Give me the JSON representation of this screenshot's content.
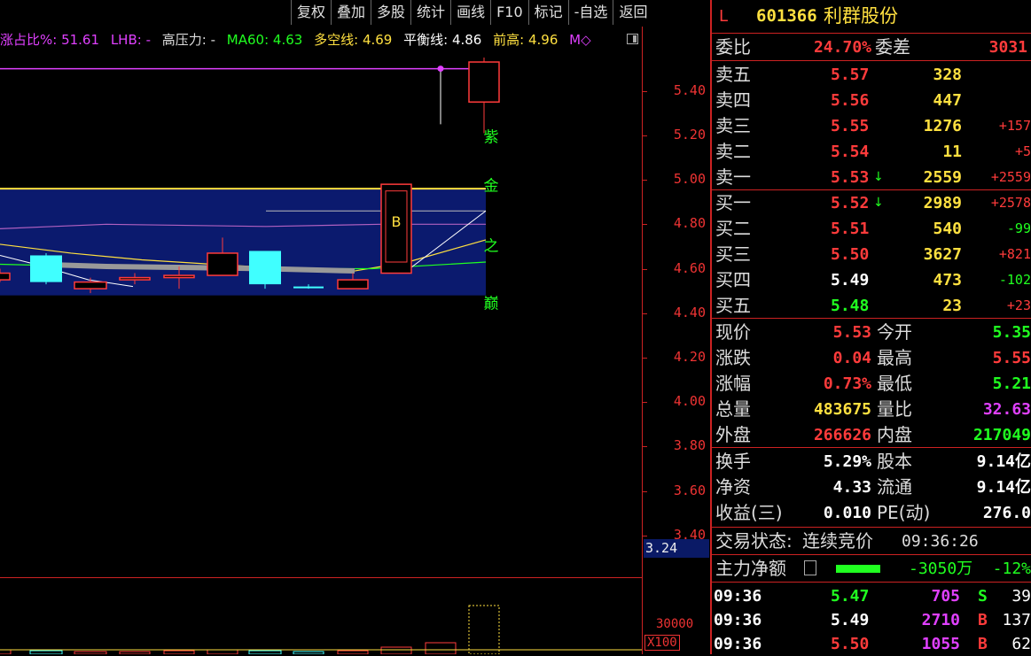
{
  "toolbar": [
    "复权",
    "叠加",
    "多股",
    "统计",
    "画线",
    "F10",
    "标记",
    "-自选",
    "返回"
  ],
  "indicator": {
    "zhan_label": "涨占比%: ",
    "zhan_value": "51.61",
    "lhb_label": "LHB: ",
    "lhb_value": "-",
    "gyl_label": "高压力: ",
    "gyl_value": "-",
    "ma60_label": "MA60: ",
    "ma60_value": "4.63",
    "dkx_label": "多空线: ",
    "dkx_value": "4.69",
    "phx_label": "平衡线: ",
    "phx_value": "4.86",
    "qg_label": "前高: ",
    "qg_value": "4.96",
    "more": "M◇"
  },
  "chart_labels": [
    "紫",
    "金",
    "之",
    "巅"
  ],
  "candle_mark": "B",
  "price_axis": [
    "5.40",
    "5.20",
    "5.00",
    "4.80",
    "4.60",
    "4.40",
    "4.20",
    "4.00",
    "3.80",
    "3.60",
    "3.40"
  ],
  "axis_current": "3.24",
  "vol_axis": "30000",
  "vol_unit": "X100",
  "header": {
    "market": "L",
    "code": "601366",
    "name": "利群股份"
  },
  "weibi": {
    "label1": "委比",
    "value1": "24.70%",
    "label2": "委差",
    "value2": "3031"
  },
  "sell": [
    {
      "label": "卖五",
      "price": "5.57",
      "vol": "328",
      "chg": ""
    },
    {
      "label": "卖四",
      "price": "5.56",
      "vol": "447",
      "chg": ""
    },
    {
      "label": "卖三",
      "price": "5.55",
      "vol": "1276",
      "chg": "+157"
    },
    {
      "label": "卖二",
      "price": "5.54",
      "vol": "11",
      "chg": "+5"
    },
    {
      "label": "卖一",
      "price": "5.53",
      "vol": "2559",
      "chg": "+2559"
    }
  ],
  "buy": [
    {
      "label": "买一",
      "price": "5.52",
      "vol": "2989",
      "chg": "+2578"
    },
    {
      "label": "买二",
      "price": "5.51",
      "vol": "540",
      "chg": "-99"
    },
    {
      "label": "买三",
      "price": "5.50",
      "vol": "3627",
      "chg": "+821"
    },
    {
      "label": "买四",
      "price": "5.49",
      "vol": "473",
      "chg": "-102"
    },
    {
      "label": "买五",
      "price": "5.48",
      "vol": "23",
      "chg": "+23"
    }
  ],
  "quote": [
    {
      "l1": "现价",
      "v1": "5.53",
      "l2": "今开",
      "v2": "5.35"
    },
    {
      "l1": "涨跌",
      "v1": "0.04",
      "l2": "最高",
      "v2": "5.55"
    },
    {
      "l1": "涨幅",
      "v1": "0.73%",
      "l2": "最低",
      "v2": "5.21"
    },
    {
      "l1": "总量",
      "v1": "483675",
      "l2": "量比",
      "v2": "32.63"
    },
    {
      "l1": "外盘",
      "v1": "266626",
      "l2": "内盘",
      "v2": "217049"
    }
  ],
  "fund": [
    {
      "l1": "换手",
      "v1": "5.29%",
      "l2": "股本",
      "v2": "9.14亿"
    },
    {
      "l1": "净资",
      "v1": "4.33",
      "l2": "流通",
      "v2": "9.14亿"
    },
    {
      "l1": "收益(三)",
      "v1": "0.010",
      "l2": "PE(动)",
      "v2": "276.0"
    }
  ],
  "status": {
    "label": "交易状态: ",
    "value": "连续竞价",
    "time": "09:36:26"
  },
  "mainforce": {
    "label": "主力净额",
    "value": "-3050万",
    "pct": "-12%"
  },
  "ticks": [
    {
      "time": "09:36",
      "price": "5.47",
      "vol": "705",
      "side": "S",
      "num": "39"
    },
    {
      "time": "09:36",
      "price": "5.49",
      "vol": "2710",
      "side": "B",
      "num": "137"
    },
    {
      "time": "09:36",
      "price": "5.50",
      "vol": "1055",
      "side": "B",
      "num": "62"
    }
  ],
  "colors": {
    "up": "#ff3b3b",
    "down": "#20ff20",
    "bg": "#000000",
    "band": "#0b1a6e",
    "accent": "#ffe040"
  },
  "chart_data": {
    "type": "candlestick",
    "ylim": [
      3.24,
      5.55
    ],
    "yticks": [
      5.4,
      5.2,
      5.0,
      4.8,
      4.6,
      4.4,
      4.2,
      4.0,
      3.8,
      3.6,
      3.4
    ],
    "candles": [
      {
        "o": 4.58,
        "c": 4.55,
        "h": 4.6,
        "l": 4.54,
        "color": "up"
      },
      {
        "o": 4.66,
        "c": 4.54,
        "h": 4.67,
        "l": 4.53,
        "color": "down"
      },
      {
        "o": 4.54,
        "c": 4.51,
        "h": 4.56,
        "l": 4.49,
        "color": "up"
      },
      {
        "o": 4.55,
        "c": 4.56,
        "h": 4.58,
        "l": 4.53,
        "color": "up"
      },
      {
        "o": 4.56,
        "c": 4.57,
        "h": 4.61,
        "l": 4.51,
        "color": "up"
      },
      {
        "o": 4.57,
        "c": 4.67,
        "h": 4.74,
        "l": 4.57,
        "color": "up"
      },
      {
        "o": 4.68,
        "c": 4.53,
        "h": 4.68,
        "l": 4.51,
        "color": "down"
      },
      {
        "o": 4.52,
        "c": 4.52,
        "h": 4.53,
        "l": 4.51,
        "color": "down"
      },
      {
        "o": 4.51,
        "c": 4.55,
        "h": 4.58,
        "l": 4.51,
        "color": "up"
      },
      {
        "o": 4.58,
        "c": 4.98,
        "h": 4.98,
        "l": 4.58,
        "color": "up"
      },
      {
        "o": 5.35,
        "c": 5.53,
        "h": 5.55,
        "l": 5.21,
        "color": "up"
      }
    ],
    "lines": {
      "prev_high": 4.96,
      "balance": 4.86,
      "magenta_high": 5.5
    }
  }
}
